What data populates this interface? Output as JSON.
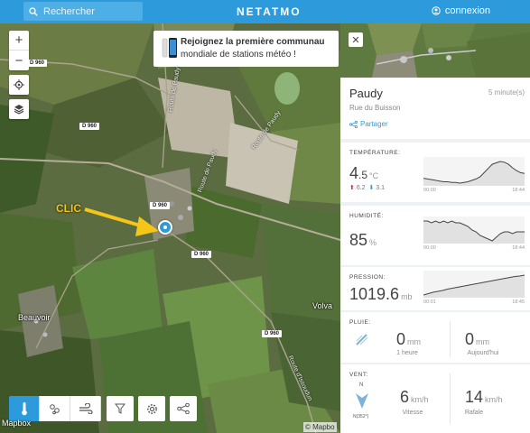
{
  "topbar": {
    "search_placeholder": "Rechercher",
    "logo": "NETATMO",
    "connexion": "connexion"
  },
  "map": {
    "controls": {
      "zoom_in": "+",
      "zoom_out": "−"
    },
    "promo": {
      "bold": "Rejoignez la première communau",
      "rest": "mondiale de stations météo !"
    },
    "roads": [
      "D 960",
      "D 960",
      "D 960",
      "D 960",
      "D 960"
    ],
    "road_names": [
      "Route de Paudy",
      "Route de Paudy",
      "Route de Paudy",
      "Route d'Issoudun"
    ],
    "places": [
      "Beauvoir",
      "Volva"
    ],
    "annotation": "CLIC",
    "mapbox": "Mapbox",
    "attribution": "© Mapbo"
  },
  "panel": {
    "station_name": "Paudy",
    "updated": "5 minute(s)",
    "street": "Rue du Buisson",
    "share": "Partager",
    "temperature": {
      "title": "TEMPÉRATURE:",
      "value_int": "4",
      "value_dec": ".5",
      "unit": "°C",
      "max": "6.2",
      "min": "3.1",
      "t_start": "00:00",
      "t_end": "18:44",
      "series": [
        3.8,
        3.7,
        3.6,
        3.5,
        3.4,
        3.3,
        3.3,
        3.2,
        3.2,
        3.1,
        3.2,
        3.3,
        3.5,
        3.7,
        4.0,
        4.6,
        5.2,
        5.8,
        6.0,
        6.2,
        6.1,
        5.8,
        5.3,
        4.9,
        4.6,
        4.5
      ]
    },
    "humidity": {
      "title": "HUMIDITÉ:",
      "value": "85",
      "unit": "%",
      "t_start": "00:00",
      "t_end": "18:44",
      "series": [
        91,
        91,
        90,
        91,
        90,
        91,
        90,
        91,
        90,
        90,
        89,
        88,
        86,
        85,
        83,
        82,
        81,
        80,
        82,
        84,
        85,
        85,
        84,
        85,
        85,
        85
      ]
    },
    "pressure": {
      "title": "PRESSION:",
      "value": "1019.6",
      "unit": "mb",
      "t_start": "00:01",
      "t_end": "18:45",
      "series": [
        1015.2,
        1015.5,
        1015.8,
        1016.0,
        1016.2,
        1016.5,
        1016.7,
        1016.9,
        1017.1,
        1017.3,
        1017.5,
        1017.7,
        1017.9,
        1018.1,
        1018.3,
        1018.5,
        1018.7,
        1018.9,
        1019.1,
        1019.3,
        1019.4,
        1019.6
      ]
    },
    "rain": {
      "title": "PLUIE:",
      "hour_value": "0",
      "hour_unit": "mm",
      "hour_label": "1 heure",
      "day_value": "0",
      "day_unit": "mm",
      "day_label": "Aujourd'hui"
    },
    "wind": {
      "title": "VENT:",
      "north": "N",
      "dir": "N(352°)",
      "speed_value": "6",
      "speed_unit": "km/h",
      "speed_label": "Vitesse",
      "gust_value": "14",
      "gust_unit": "km/h",
      "gust_label": "Rafale"
    }
  },
  "colors": {
    "accent": "#2d9bdb",
    "annotation": "#f5c518"
  }
}
